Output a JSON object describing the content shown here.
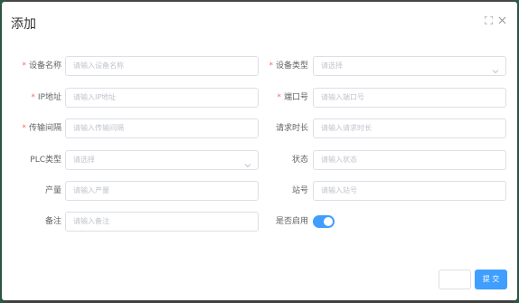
{
  "dialog": {
    "title": "添加",
    "colors": {
      "primary": "#409eff",
      "required": "#f56c6c"
    }
  },
  "form": {
    "device_name": {
      "label": "设备名称",
      "placeholder": "请输入设备名称",
      "required": true
    },
    "device_type": {
      "label": "设备类型",
      "placeholder": "请选择",
      "required": true,
      "icon": "chevron-down-icon"
    },
    "ip_address": {
      "label": "IP地址",
      "placeholder": "请输入IP地址",
      "required": true
    },
    "port": {
      "label": "端口号",
      "placeholder": "请输入端口号",
      "required": true
    },
    "transfer_interval": {
      "label": "传输间隔",
      "placeholder": "请输入传输间隔",
      "required": true
    },
    "request_duration": {
      "label": "请求时长",
      "placeholder": "请输入请求时长",
      "required": false
    },
    "plc_type": {
      "label": "PLC类型",
      "placeholder": "请选择",
      "required": false,
      "icon": "chevron-down-icon"
    },
    "status": {
      "label": "状态",
      "placeholder": "请输入状态",
      "required": false
    },
    "output": {
      "label": "产量",
      "placeholder": "请输入产量",
      "required": false
    },
    "station_no": {
      "label": "站号",
      "placeholder": "请输入站号",
      "required": false
    },
    "remark": {
      "label": "备注",
      "placeholder": "请输入备注",
      "required": false
    },
    "enabled": {
      "label": "是否启用",
      "value": true
    }
  },
  "footer": {
    "submit_label": "提 交",
    "cancel_label": ""
  }
}
